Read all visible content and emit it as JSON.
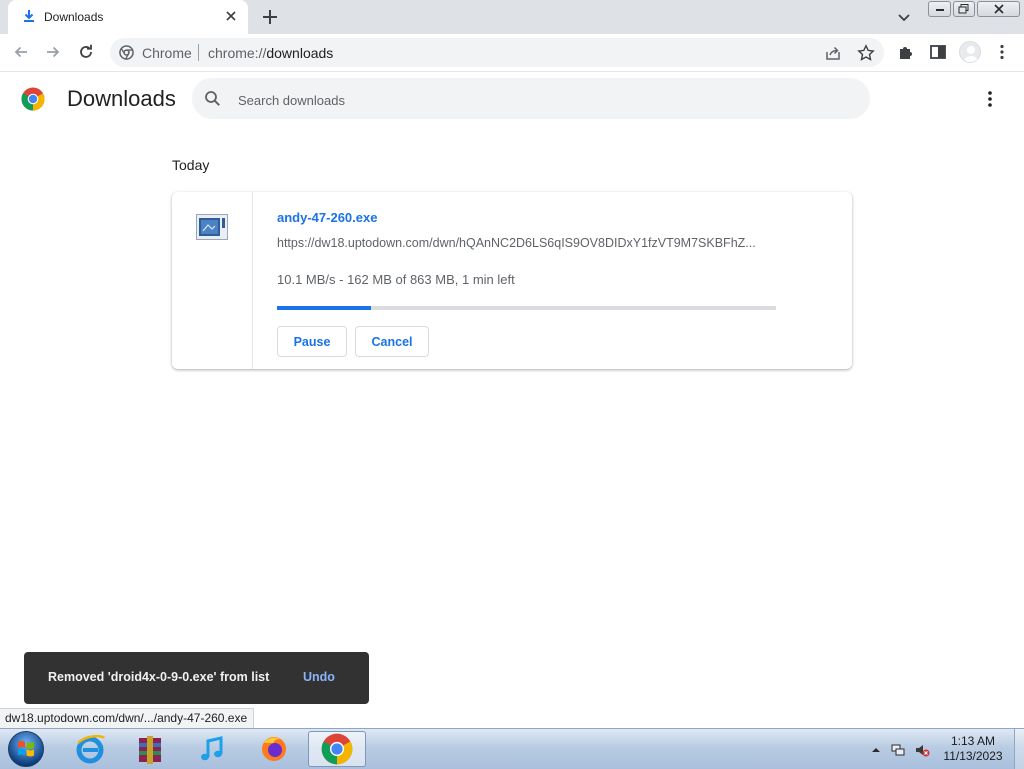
{
  "tab": {
    "title": "Downloads"
  },
  "omnibox": {
    "site_name": "Chrome",
    "url_scheme": "chrome://",
    "url_host": "downloads"
  },
  "page": {
    "title": "Downloads",
    "search_placeholder": "Search downloads"
  },
  "list": {
    "date_label": "Today",
    "items": [
      {
        "file_name": "andy-47-260.exe",
        "url": "https://dw18.uptodown.com/dwn/hQAnNC2D6LS6qIS9OV8DIDxY1fzVT9M7SKBFhZ...",
        "status": "10.1 MB/s - 162 MB of 863 MB, 1 min left",
        "progress": 0.188,
        "pause_label": "Pause",
        "cancel_label": "Cancel"
      }
    ]
  },
  "toast": {
    "message": "Removed 'droid4x-0-9-0.exe' from list",
    "undo_label": "Undo"
  },
  "status_bubble": "dw18.uptodown.com/dwn/.../andy-47-260.exe",
  "taskbar": {
    "apps": [
      {
        "icon": "internet-explorer-icon"
      },
      {
        "icon": "winrar-icon"
      },
      {
        "icon": "itunes-icon"
      },
      {
        "icon": "firefox-icon"
      },
      {
        "icon": "chrome-icon",
        "active": true
      }
    ],
    "time": "1:13 AM",
    "date": "11/13/2023"
  },
  "colors": {
    "accent": "#1a73e8",
    "toast_bg": "#323232",
    "undo": "#8ab4f8"
  }
}
